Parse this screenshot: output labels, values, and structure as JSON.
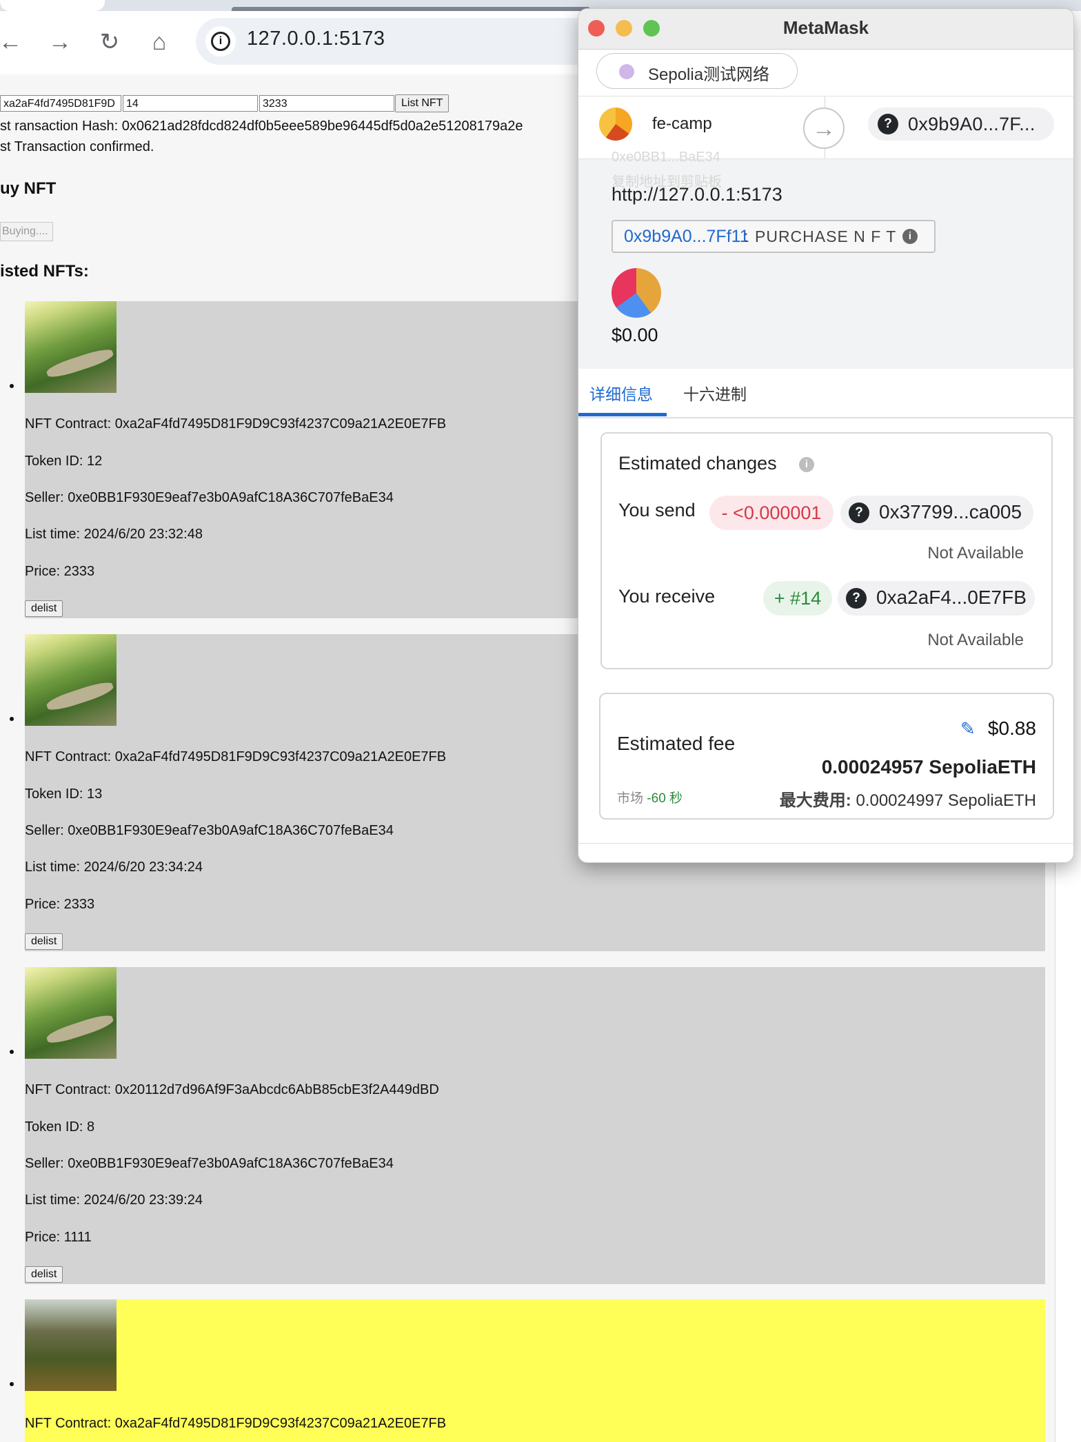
{
  "browser": {
    "url": "127.0.0.1:5173",
    "nav": {
      "back": "←",
      "forward": "→",
      "reload": "↻",
      "home": "⌂"
    }
  },
  "page": {
    "form": {
      "contract_value": "xa2aF4fd7495D81F9D",
      "token_value": "14",
      "price_value": "3233",
      "list_button": "List NFT"
    },
    "list_tx_hash": "st ransaction Hash: 0x0621ad28fdcd824df0b5eee589be96445df5d0a2e51208179a2e",
    "list_tx_status": "st Transaction confirmed.",
    "buy_heading": "uy NFT",
    "buying_button": "Buying....",
    "listed_heading": "isted NFTs:",
    "nfts": [
      {
        "contract": "NFT Contract: 0xa2aF4fd7495D81F9D9C93f4237C09a21A2E0E7FB",
        "token": "Token ID: 12",
        "seller": "Seller: 0xe0BB1F930E9eaf7e3b0A9afC18A36C707feBaE34",
        "time": "List time: 2024/6/20 23:32:48",
        "price": "Price: 2333",
        "delist": "delist"
      },
      {
        "contract": "NFT Contract: 0xa2aF4fd7495D81F9D9C93f4237C09a21A2E0E7FB",
        "token": "Token ID: 13",
        "seller": "Seller: 0xe0BB1F930E9eaf7e3b0A9afC18A36C707feBaE34",
        "time": "List time: 2024/6/20 23:34:24",
        "price": "Price: 2333",
        "delist": "delist"
      },
      {
        "contract": "NFT Contract: 0x20112d7d96Af9F3aAbcdc6AbB85cbE3f2A449dBD",
        "token": "Token ID: 8",
        "seller": "Seller: 0xe0BB1F930E9eaf7e3b0A9afC18A36C707feBaE34",
        "time": "List time: 2024/6/20 23:39:24",
        "price": "Price: 1111",
        "delist": "delist"
      },
      {
        "contract": "NFT Contract: 0xa2aF4fd7495D81F9D9C93f4237C09a21A2E0E7FB",
        "highlight": "#ffff57"
      }
    ]
  },
  "metamask": {
    "title": "MetaMask",
    "network": "Sepolia测试网络",
    "account_name": "fe-camp",
    "to_address": "0x9b9A0...7F...",
    "ghost_text_1": "0xe0BB1...BaE34",
    "ghost_text_2": "复制地址到剪贴板",
    "origin": "http://127.0.0.1:5173",
    "method_address": "0x9b9A0...7Ff11",
    "method_sep": ":",
    "method_name": "PURCHASE N F T",
    "value_usd": "$0.00",
    "tabs": {
      "details": "详细信息",
      "hex": "十六进制"
    },
    "estimated_changes": {
      "title": "Estimated changes",
      "send_label": "You send",
      "send_amount": "- <0.000001",
      "send_address": "0x37799...ca005",
      "send_note": "Not Available",
      "receive_label": "You receive",
      "receive_amount": "+ #14",
      "receive_address": "0xa2aF4...0E7FB",
      "receive_note": "Not Available"
    },
    "fee": {
      "label": "Estimated fee",
      "usd": "$0.88",
      "eth": "0.00024957 SepoliaETH",
      "market": "市场",
      "market_time": "-60 秒",
      "max_label": "最大费用:",
      "max_value": "0.00024997 SepoliaETH"
    },
    "colors": {
      "accent": "#1f6ad1",
      "send": "#d33a48",
      "receive": "#2c8c3b"
    }
  }
}
